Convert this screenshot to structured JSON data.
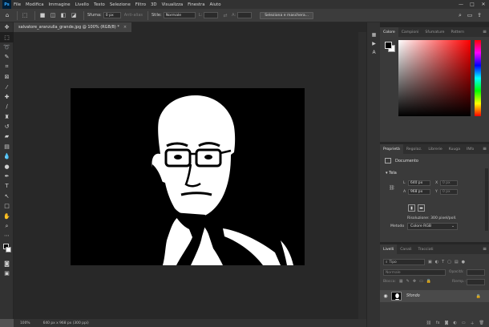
{
  "app": {
    "logo": "Ps"
  },
  "menu": [
    "File",
    "Modifica",
    "Immagine",
    "Livello",
    "Testo",
    "Selezione",
    "Filtro",
    "3D",
    "Visualizza",
    "Finestra",
    "Aiuto"
  ],
  "window_controls": {
    "minimize": "—",
    "maximize": "□",
    "close": "✕"
  },
  "options": {
    "sfuma_label": "Sfuma:",
    "sfuma_value": "0 px",
    "antialias_label": "Anti-alias",
    "stile_label": "Stile:",
    "stile_value": "Normale",
    "l_label": "L:",
    "a_label": "A:",
    "select_mask_button": "Seleziona e maschera..."
  },
  "document": {
    "tab_title": "salvatore_aranzulla_grande.jpg @ 100% (RGB/8) *",
    "close": "×"
  },
  "status": {
    "zoom": "100%",
    "info": "640 px x 968 px (300 ppi)"
  },
  "color_panel": {
    "tabs": [
      "Colore",
      "Campioni",
      "Sfumature",
      "Pattern"
    ],
    "active": 0
  },
  "properties_panel": {
    "tabs": [
      "Proprietà",
      "Regolaz.",
      "Librerie",
      "Kuuga",
      "INfo"
    ],
    "active": 0,
    "document_label": "Documento",
    "section_label": "Tela",
    "l_label": "L",
    "l_value": "640 px",
    "x_label": "X",
    "x_value": "0 px",
    "a_label": "A",
    "a_value": "968 px",
    "y_label": "Y",
    "y_value": "0 px",
    "resolution": "Risoluzione: 300 pixel/poll.",
    "mode_label": "Metodo",
    "mode_value": "Colore RGB"
  },
  "layers_panel": {
    "tabs": [
      "Livelli",
      "Canali",
      "Tracciati"
    ],
    "active": 0,
    "filter_placeholder": "Tipo",
    "blend_mode": "Normale",
    "opacity_label": "Opacità:",
    "lock_label": "Blocca:",
    "fill_label": "Riemp.:",
    "layer_name": "Sfondo"
  },
  "icons": {
    "toolbar": [
      "move-icon",
      "marquee-icon",
      "lasso-icon",
      "quick-select-icon",
      "crop-icon",
      "frame-icon",
      "eyedropper-icon",
      "healing-icon",
      "brush-icon",
      "clone-stamp-icon",
      "history-brush-icon",
      "eraser-icon",
      "gradient-icon",
      "blur-icon",
      "dodge-icon",
      "pen-icon",
      "type-icon",
      "path-select-icon",
      "rectangle-icon",
      "hand-icon",
      "zoom-icon",
      "more-icon",
      "color-swatch-icon",
      "mask-icon",
      "screen-mode-icon"
    ],
    "side_column": [
      "history-panel-icon",
      "actions-panel-icon",
      "character-panel-icon"
    ]
  }
}
